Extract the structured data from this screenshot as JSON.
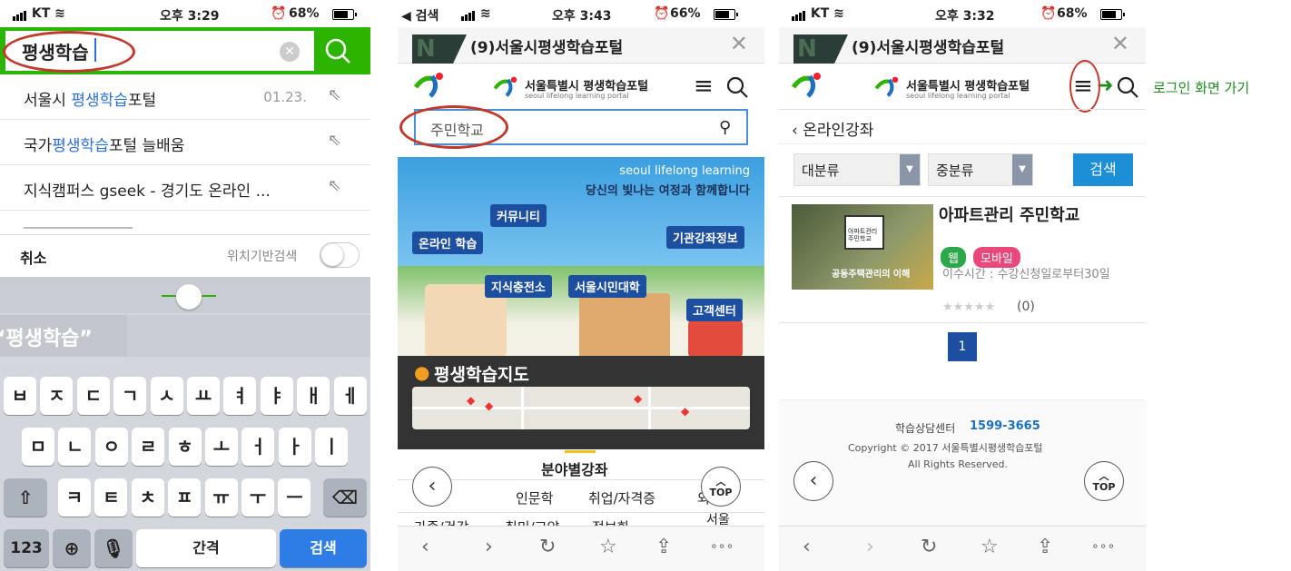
{
  "colors": {
    "naver_green": "#2db400",
    "link_blue": "#2e6fd6",
    "annotation_red": "#c0392b",
    "annotation_green": "#1e8c1e",
    "page_blue": "#1d6fc0"
  },
  "phone1": {
    "status": {
      "carrier": "KT",
      "time": "오후 3:29",
      "battery": "68%",
      "battery_level": 0.68
    },
    "search": {
      "query": "평생학습",
      "clear_icon": "clear-icon",
      "search_icon": "search-icon"
    },
    "suggestions": [
      {
        "prefix": "서울시 ",
        "highlight": "평생학습",
        "suffix": "포털",
        "date": "01.23."
      },
      {
        "prefix": "국가",
        "highlight": "평생학습",
        "suffix": "포털 늘배움",
        "date": ""
      },
      {
        "prefix": "지식캠퍼스 gseek - 경기도 온라인 ...",
        "highlight": "",
        "suffix": "",
        "date": ""
      }
    ],
    "cancel_label": "취소",
    "location_label": "위치기반검색",
    "prediction": "“평생학습”",
    "keyboard": {
      "row1": [
        "ㅂ",
        "ㅈ",
        "ㄷ",
        "ㄱ",
        "ㅅ",
        "ㅛ",
        "ㅕ",
        "ㅑ",
        "ㅐ",
        "ㅔ"
      ],
      "row2": [
        "ㅁ",
        "ㄴ",
        "ㅇ",
        "ㄹ",
        "ㅎ",
        "ㅗ",
        "ㅓ",
        "ㅏ",
        "ㅣ"
      ],
      "row3": [
        "ㅋ",
        "ㅌ",
        "ㅊ",
        "ㅍ",
        "ㅠ",
        "ㅜ",
        "ㅡ"
      ],
      "shift": "⇧",
      "backspace": "⌫",
      "num_label": "123",
      "space_label": "간격",
      "search_label": "검색"
    }
  },
  "phone2": {
    "status": {
      "back_app": "◀ 검색",
      "time": "오후 3:43",
      "battery": "66%",
      "battery_level": 0.66
    },
    "tab_title": "(9)서울시평생학습포털",
    "site_title": "서울특별시 평생학습포털",
    "site_sub": "seoul lifelong learning portal",
    "search_value": "주민학교",
    "hero": {
      "tagline_en": "seoul lifelong learning",
      "tagline_ko": "당신의 빛나는 여정과 함께합니다",
      "tags": [
        "커뮤니티",
        "온라인 학습",
        "기관강좌정보",
        "지식충전소",
        "서울시민대학",
        "고객센터"
      ]
    },
    "map_title": "평생학습지도",
    "section_title": "분야별강좌",
    "categories_row1": [
      "인문학",
      "취업/자격증",
      "외"
    ],
    "categories_row2": [
      "가족/건강",
      "취미/교양",
      "정보화",
      "서울"
    ],
    "top_label": "TOP"
  },
  "phone3": {
    "status": {
      "carrier": "KT",
      "time": "오후 3:32",
      "battery": "68%",
      "battery_level": 0.68
    },
    "tab_title": "(9)서울시평생학습포털",
    "site_title": "서울특별시 평생학습포털",
    "site_sub": "seoul lifelong learning portal",
    "annotation": "로그인 화면 가기",
    "breadcrumb": "온라인강좌",
    "filter1": "대분류",
    "filter2": "중분류",
    "search_button": "검색",
    "course": {
      "title": "아파트관리 주민학교",
      "thumb_caption": "공동주택관리의 이해",
      "thumb_sign": "아파트관리 주민학교",
      "badge_web": "웹",
      "badge_mobile": "모바일",
      "period": "이수시간 : 수강신청일로부터30일",
      "rating_count": "(0)"
    },
    "page": "1",
    "footer": {
      "center_label": "학습상담센터",
      "phone": "1599-3665",
      "copyright": "Copyright © 2017 서울특별시평생학습포털",
      "rights": "All Rights Reserved."
    },
    "top_label": "TOP"
  }
}
